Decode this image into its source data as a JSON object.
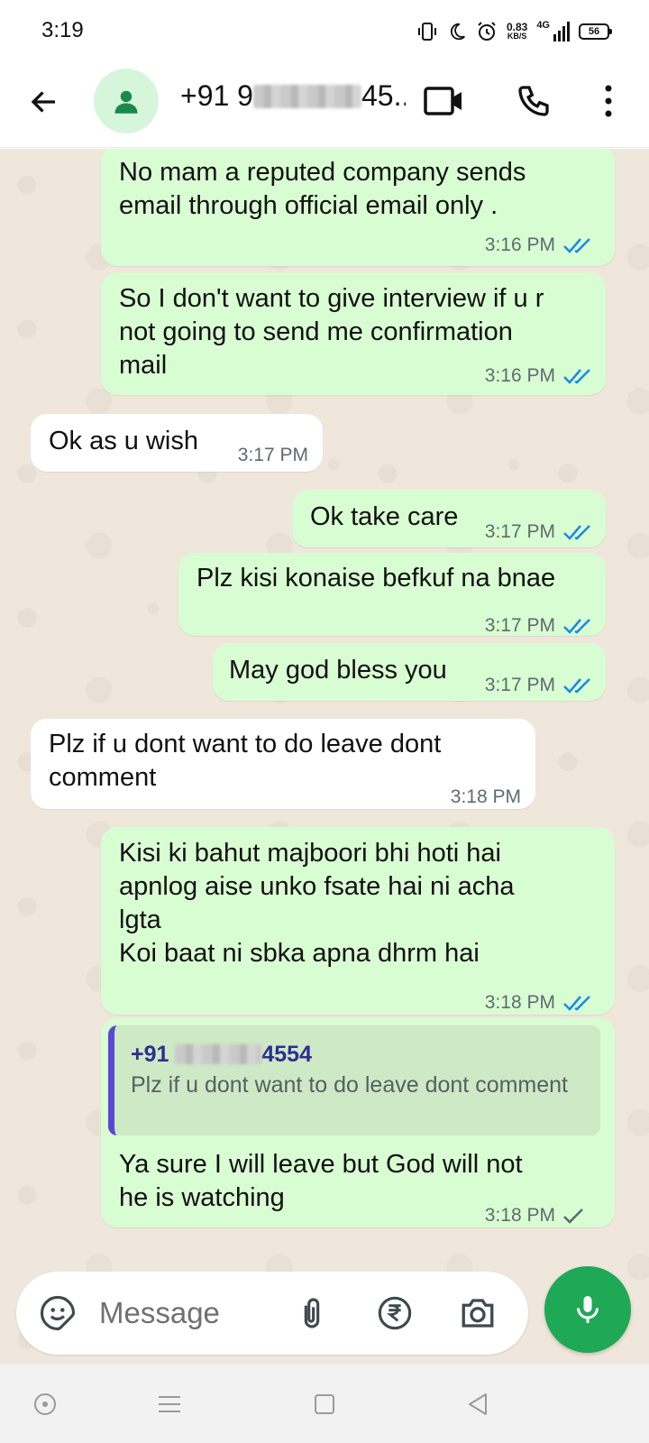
{
  "status_bar": {
    "time": "3:19",
    "net_speed_value": "0.83",
    "net_speed_unit": "KB/S",
    "network_type": "4G",
    "battery": "56"
  },
  "header": {
    "contact_prefix": "+91 9",
    "contact_suffix": "45..."
  },
  "messages": [
    {
      "direction": "outgoing",
      "text": "No mam a reputed company sends\nemail through official email only .",
      "time": "3:16 PM",
      "status": "read"
    },
    {
      "direction": "outgoing",
      "text": "So I don't want to give interview if u r\nnot going to send me confirmation\nmail",
      "time": "3:16 PM",
      "status": "read"
    },
    {
      "direction": "incoming",
      "text": "Ok as u wish",
      "time": "3:17 PM"
    },
    {
      "direction": "outgoing",
      "text": "Ok take care",
      "time": "3:17 PM",
      "status": "read"
    },
    {
      "direction": "outgoing",
      "text": "Plz kisi konaise befkuf na bnae",
      "time": "3:17 PM",
      "status": "read"
    },
    {
      "direction": "outgoing",
      "text": "May god bless you",
      "time": "3:17 PM",
      "status": "read"
    },
    {
      "direction": "incoming",
      "text": "Plz if u dont want to do leave dont\ncomment",
      "time": "3:18 PM"
    },
    {
      "direction": "outgoing",
      "text": "Kisi ki bahut majboori bhi hoti hai\napnlog aise unko fsate hai ni acha\nlgta\nKoi baat ni sbka apna dhrm hai",
      "time": "3:18 PM",
      "status": "read"
    },
    {
      "direction": "outgoing",
      "text": "Ya sure I will leave but God will not\nhe is watching",
      "time": "3:18 PM",
      "status": "sent",
      "reply_to": {
        "name_prefix": "+91",
        "name_suffix": "4554",
        "text": "Plz if u dont want to do leave dont\ncomment"
      }
    }
  ],
  "composer": {
    "placeholder": "Message"
  },
  "colors": {
    "outgoing_bubble": "#d9fdd3",
    "incoming_bubble": "#ffffff",
    "read_tick": "#1d8ce0",
    "accent_green": "#1fa855",
    "chat_background": "#efe7dc",
    "quote_bar": "#5b47d3"
  },
  "icons": {
    "back": "arrow-left-icon",
    "avatar": "person-icon",
    "video": "video-camera-icon",
    "call": "phone-icon",
    "menu": "more-vertical-icon",
    "emoji": "sticker-icon",
    "attach": "paperclip-icon",
    "payment": "rupee-icon",
    "camera": "camera-icon",
    "mic": "microphone-icon"
  }
}
